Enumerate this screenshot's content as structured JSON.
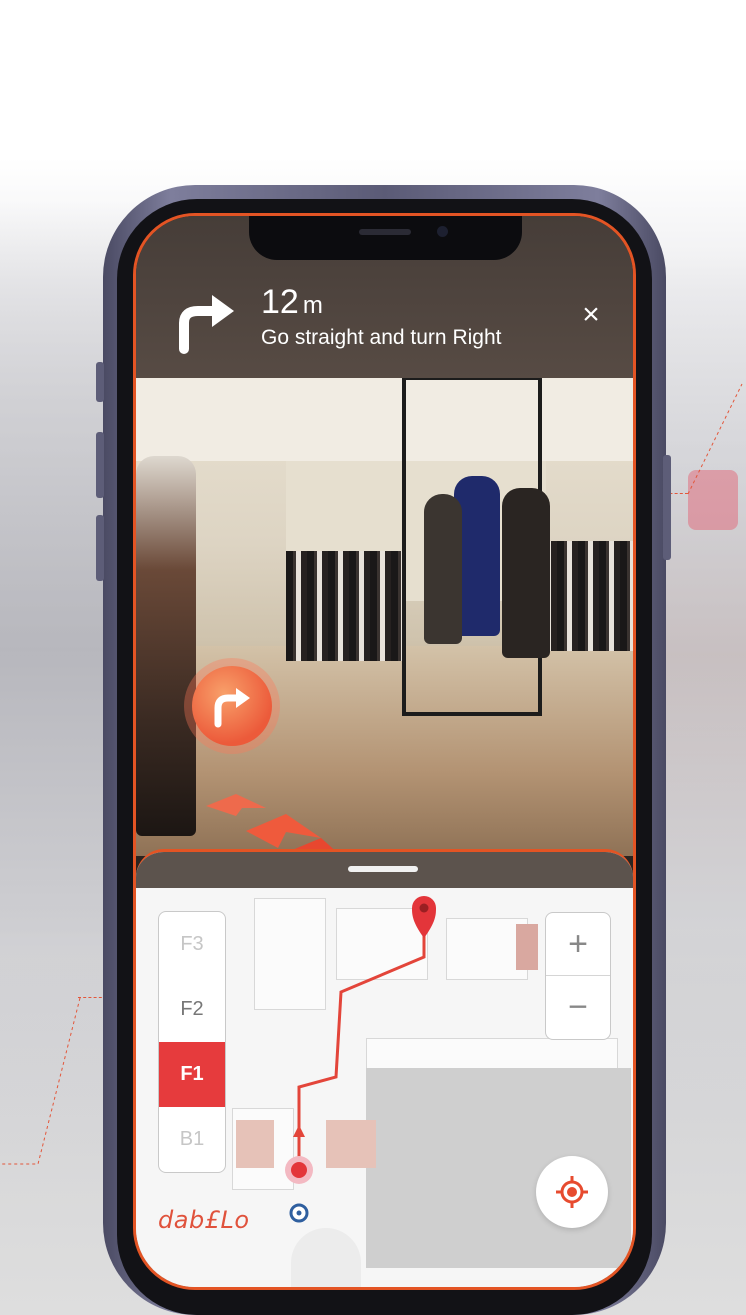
{
  "navigation": {
    "distance_value": "12",
    "distance_unit": "m",
    "instruction": "Go straight and turn Right",
    "close_symbol": "×",
    "turn_icon": "turn-right-arrow-icon"
  },
  "floor_selector": {
    "floors": [
      "F3",
      "F2",
      "F1",
      "B1"
    ],
    "active": "F1"
  },
  "zoom_controls": {
    "zoom_in_label": "+",
    "zoom_out_label": "−"
  },
  "brand": {
    "logo_text": "dab£Lo"
  },
  "colors": {
    "accent": "#e35424",
    "active_floor": "#e63b3d",
    "route": "#e3453a",
    "user_marker": "#2f5f9f"
  }
}
